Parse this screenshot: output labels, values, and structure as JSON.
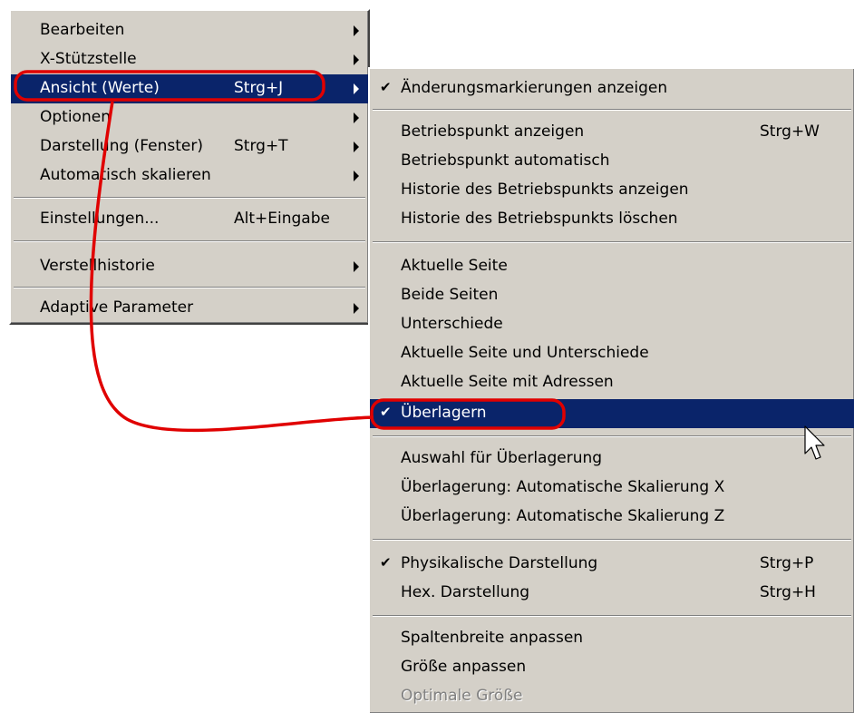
{
  "main_menu": {
    "items": [
      {
        "label": "Bearbeiten",
        "shortcut": ""
      },
      {
        "label": "X-Stützstelle",
        "shortcut": ""
      },
      {
        "label": "Ansicht (Werte)",
        "shortcut": "Strg+J"
      },
      {
        "label": "Optionen",
        "shortcut": ""
      },
      {
        "label": "Darstellung (Fenster)",
        "shortcut": "Strg+T"
      },
      {
        "label": "Automatisch skalieren",
        "shortcut": ""
      },
      {
        "label": "Einstellungen...",
        "shortcut": "Alt+Eingabe"
      },
      {
        "label": "Verstellhistorie",
        "shortcut": ""
      },
      {
        "label": "Adaptive Parameter",
        "shortcut": ""
      }
    ]
  },
  "sub_menu": {
    "items": [
      {
        "label": "Änderungsmarkierungen anzeigen",
        "shortcut": "",
        "checked": true
      },
      {
        "label": "Betriebspunkt anzeigen",
        "shortcut": "Strg+W"
      },
      {
        "label": "Betriebspunkt automatisch",
        "shortcut": ""
      },
      {
        "label": "Historie des Betriebspunkts anzeigen",
        "shortcut": ""
      },
      {
        "label": "Historie des Betriebspunkts löschen",
        "shortcut": ""
      },
      {
        "label": "Aktuelle Seite",
        "shortcut": ""
      },
      {
        "label": "Beide Seiten",
        "shortcut": ""
      },
      {
        "label": "Unterschiede",
        "shortcut": ""
      },
      {
        "label": "Aktuelle Seite und Unterschiede",
        "shortcut": ""
      },
      {
        "label": "Aktuelle Seite mit Adressen",
        "shortcut": ""
      },
      {
        "label": "Überlagern",
        "shortcut": "",
        "checked": true
      },
      {
        "label": "Auswahl für Überlagerung",
        "shortcut": ""
      },
      {
        "label": "Überlagerung: Automatische Skalierung X",
        "shortcut": ""
      },
      {
        "label": "Überlagerung: Automatische Skalierung Z",
        "shortcut": ""
      },
      {
        "label": "Physikalische Darstellung",
        "shortcut": "Strg+P",
        "checked": true
      },
      {
        "label": "Hex. Darstellung",
        "shortcut": "Strg+H"
      },
      {
        "label": "Spaltenbreite anpassen",
        "shortcut": ""
      },
      {
        "label": "Größe anpassen",
        "shortcut": ""
      },
      {
        "label": "Optimale Größe",
        "shortcut": "",
        "disabled": true
      }
    ]
  },
  "symbols": {
    "check": "✔"
  },
  "colors": {
    "menu_bg": "#d4d0c8",
    "highlight": "#0a246a",
    "annotation": "#e00000"
  }
}
